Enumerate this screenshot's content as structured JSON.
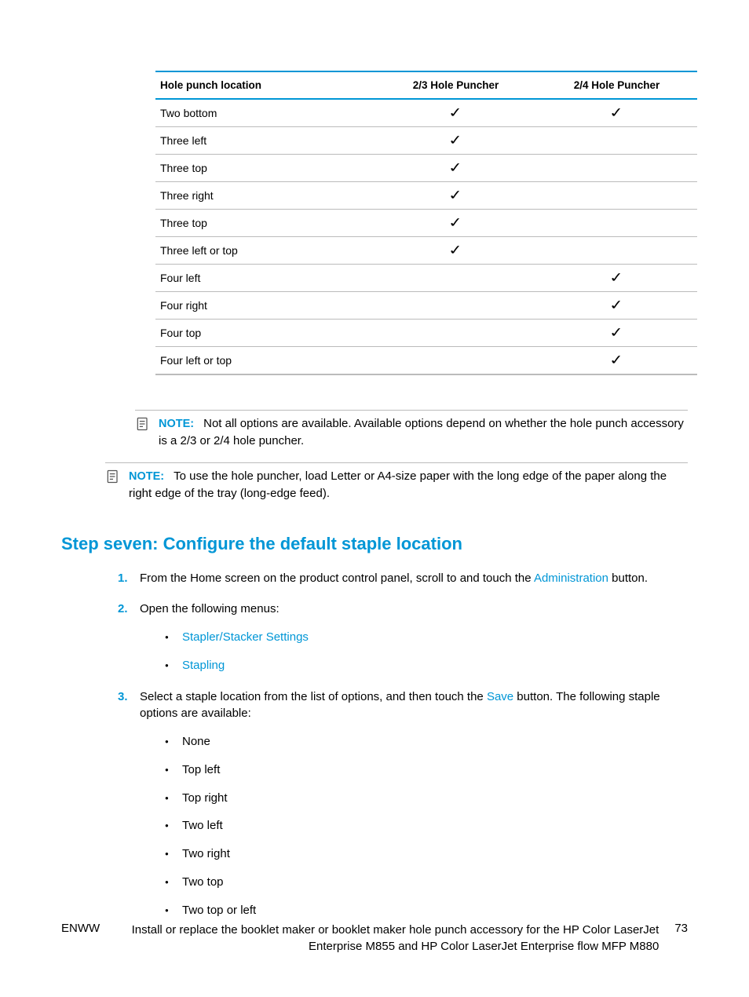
{
  "table": {
    "headers": [
      "Hole punch location",
      "2/3 Hole Puncher",
      "2/4 Hole Puncher"
    ],
    "rows": [
      {
        "loc": "Two bottom",
        "c23": true,
        "c24": true
      },
      {
        "loc": "Three left",
        "c23": true,
        "c24": false
      },
      {
        "loc": "Three top",
        "c23": true,
        "c24": false
      },
      {
        "loc": "Three right",
        "c23": true,
        "c24": false
      },
      {
        "loc": "Three top",
        "c23": true,
        "c24": false
      },
      {
        "loc": "Three left or top",
        "c23": true,
        "c24": false
      },
      {
        "loc": "Four left",
        "c23": false,
        "c24": true
      },
      {
        "loc": "Four right",
        "c23": false,
        "c24": true
      },
      {
        "loc": "Four top",
        "c23": false,
        "c24": true
      },
      {
        "loc": "Four left or top",
        "c23": false,
        "c24": true
      }
    ]
  },
  "note1": {
    "label": "NOTE:",
    "text": "Not all options are available. Available options depend on whether the hole punch accessory is a 2/3 or 2/4 hole puncher."
  },
  "note2": {
    "label": "NOTE:",
    "text": "To use the hole puncher, load Letter or A4-size paper with the long edge of the paper along the right edge of the tray (long-edge feed)."
  },
  "heading": "Step seven: Configure the default staple location",
  "steps": {
    "s1_pre": "From the Home screen on the product control panel, scroll to and touch the ",
    "s1_link": "Administration",
    "s1_post": " button.",
    "s2": "Open the following menus:",
    "s2_bullets": [
      "Stapler/Stacker Settings",
      "Stapling"
    ],
    "s3_pre": "Select a staple location from the list of options, and then touch the ",
    "s3_link": "Save",
    "s3_post": " button. The following staple options are available:",
    "s3_bullets": [
      "None",
      "Top left",
      "Top right",
      "Two left",
      "Two right",
      "Two top",
      "Two top or left"
    ]
  },
  "footer": {
    "left": "ENWW",
    "center": "Install or replace the booklet maker or booklet maker hole punch accessory for the HP Color LaserJet Enterprise M855 and HP Color LaserJet Enterprise flow MFP M880",
    "right": "73"
  }
}
